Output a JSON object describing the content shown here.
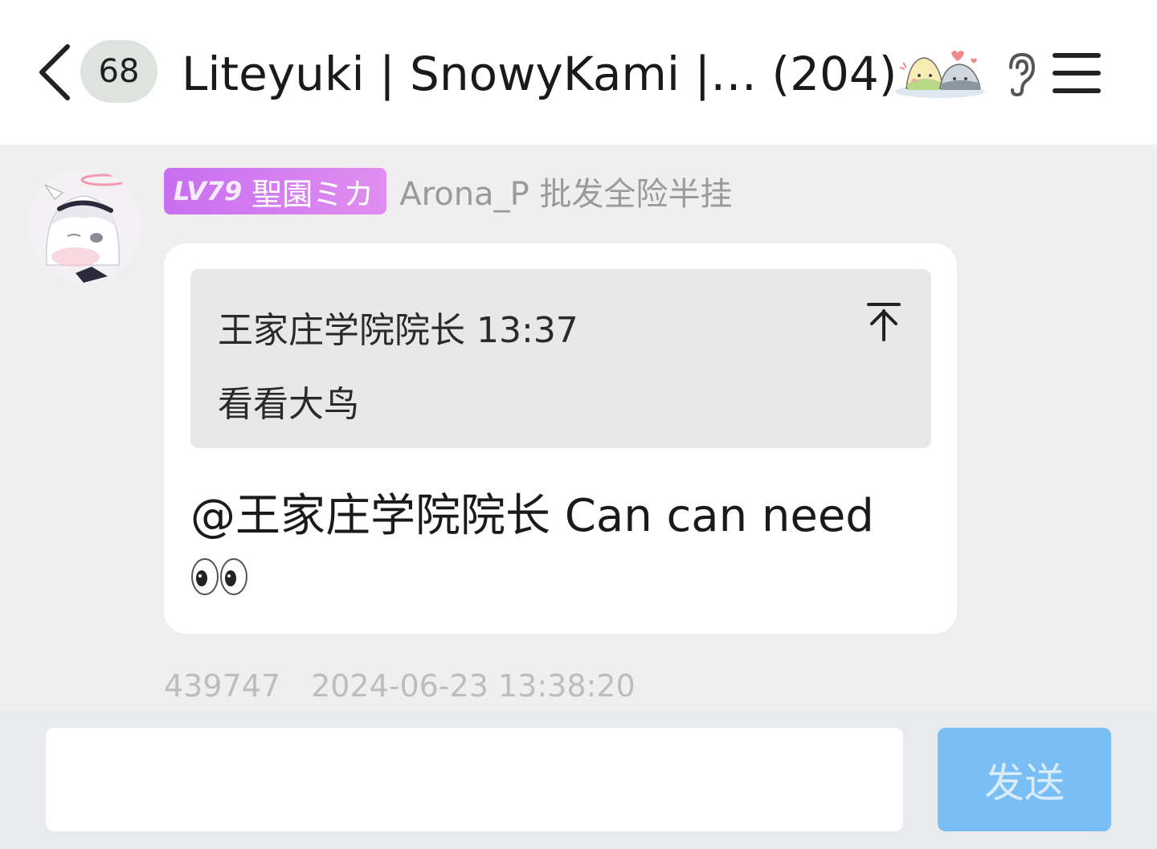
{
  "header": {
    "unread_count": "68",
    "chat_title": "Liteyuki | SnowyKami |…  (204)",
    "icons": {
      "back": "chevron-left-icon",
      "sticker": "rice-ball-sticker",
      "ear": "ear-icon",
      "menu": "hamburger-menu-icon"
    }
  },
  "message": {
    "sender_level": "LV79",
    "sender_title": "聖園ミカ",
    "sender_name": "Arona_P 批发全险半挂",
    "quote": {
      "author": "王家庄学院院长",
      "time": "13:37",
      "text": "看看大鸟"
    },
    "text": "@王家庄学院院长 Can can need",
    "emoji": "eyes-emoji",
    "message_id": "439747",
    "timestamp": "2024-06-23 13:38:20"
  },
  "composer": {
    "input_value": "",
    "input_placeholder": "",
    "send_label": "发送"
  },
  "colors": {
    "badge_gradient_start": "#c86ef0",
    "badge_gradient_end": "#e08ef0",
    "send_button": "#79bff5",
    "chat_background": "#efefef"
  }
}
